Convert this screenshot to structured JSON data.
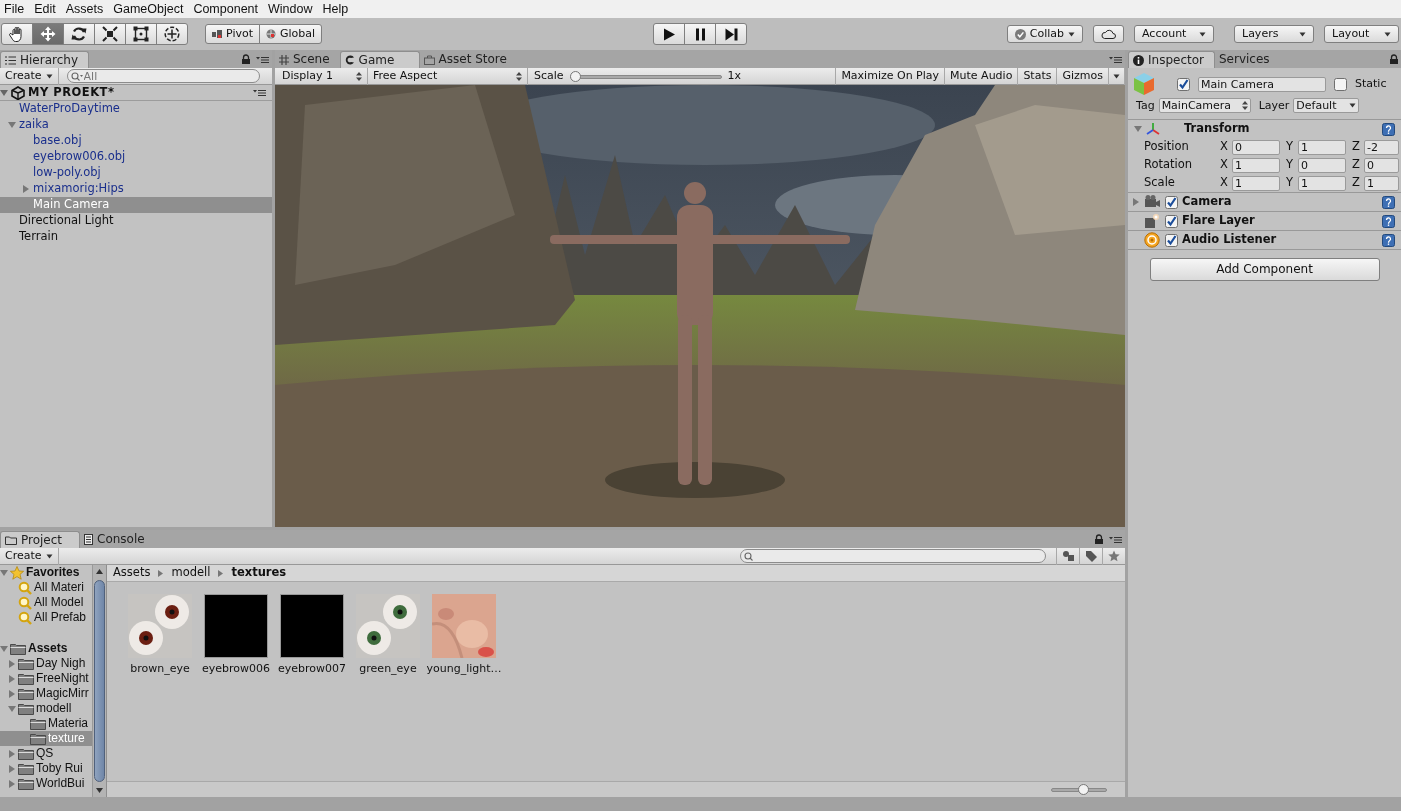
{
  "menu": [
    "File",
    "Edit",
    "Assets",
    "GameObject",
    "Component",
    "Window",
    "Help"
  ],
  "toolbar": {
    "tools": [
      {
        "kind": "hand",
        "selected": false
      },
      {
        "kind": "move",
        "selected": true
      },
      {
        "kind": "rotate",
        "selected": false
      },
      {
        "kind": "scale",
        "selected": false
      },
      {
        "kind": "rect",
        "selected": false
      },
      {
        "kind": "transform",
        "selected": false
      }
    ],
    "handles": [
      {
        "kind": "pivot",
        "label": "Pivot"
      },
      {
        "kind": "global",
        "label": "Global"
      }
    ],
    "playback": [
      {
        "kind": "play"
      },
      {
        "kind": "pause"
      },
      {
        "kind": "step"
      }
    ],
    "collab": "Collab",
    "account": "Account",
    "layers": "Layers",
    "layout": "Layout"
  },
  "hierarchy": {
    "tab": "Hierarchy",
    "create": "Create",
    "search": {
      "placeholder": "All"
    },
    "scene": "MY PROEKT*",
    "items": [
      {
        "label": "WaterProDaytime",
        "kind": "prefab",
        "selected": false
      },
      {
        "label": "zaika",
        "kind": "prefab",
        "selected": false,
        "expanded": true,
        "children": [
          {
            "label": "base.obj",
            "kind": "prefab",
            "selected": false
          },
          {
            "label": "eyebrow006.obj",
            "kind": "prefab",
            "selected": false
          },
          {
            "label": "low-poly.obj",
            "kind": "prefab",
            "selected": false
          },
          {
            "label": "mixamorig:Hips",
            "kind": "prefab",
            "selected": false,
            "expanded": false
          },
          {
            "label": "Main Camera",
            "kind": "object",
            "selected": true
          }
        ]
      },
      {
        "label": "Directional Light",
        "kind": "object",
        "selected": false
      },
      {
        "label": "Terrain",
        "kind": "object",
        "selected": false
      }
    ]
  },
  "game": {
    "tabs": [
      {
        "label": "Scene",
        "kind": "scene",
        "selected": false
      },
      {
        "label": "Game",
        "kind": "game",
        "selected": true
      },
      {
        "label": "Asset Store",
        "kind": "store",
        "selected": false
      }
    ],
    "display": "Display 1",
    "aspect": "Free Aspect",
    "scale_label": "Scale",
    "scale": {
      "level": 0.0
    },
    "scale_reading": "1x",
    "toggles": [
      {
        "label": "Maximize On Play",
        "on": false
      },
      {
        "label": "Mute Audio",
        "on": false
      },
      {
        "label": "Stats",
        "on": false
      },
      {
        "label": "Gizmos",
        "on": false
      }
    ]
  },
  "inspector": {
    "tabs": [
      {
        "label": "Inspector",
        "selected": true
      },
      {
        "label": "Services",
        "selected": false
      }
    ],
    "object": {
      "active": true,
      "name": "Main Camera",
      "static": false,
      "static_label": "Static",
      "tag_label": "Tag",
      "tag": "MainCamera",
      "layer_label": "Layer",
      "layer": "Default"
    },
    "transform": {
      "title": "Transform",
      "rows": [
        {
          "label": "Position",
          "fields": [
            {
              "axis": "X",
              "value": "0"
            },
            {
              "axis": "Y",
              "value": "1"
            },
            {
              "axis": "Z",
              "value": "-2"
            }
          ]
        },
        {
          "label": "Rotation",
          "fields": [
            {
              "axis": "X",
              "value": "1"
            },
            {
              "axis": "Y",
              "value": "0"
            },
            {
              "axis": "Z",
              "value": "0"
            }
          ]
        },
        {
          "label": "Scale",
          "fields": [
            {
              "axis": "X",
              "value": "1"
            },
            {
              "axis": "Y",
              "value": "1"
            },
            {
              "axis": "Z",
              "value": "1"
            }
          ]
        }
      ]
    },
    "components": [
      {
        "kind": "camera",
        "name": "Camera",
        "enabled": true,
        "expanded": false
      },
      {
        "kind": "flare",
        "name": "Flare Layer",
        "enabled": true
      },
      {
        "kind": "audio",
        "name": "Audio Listener",
        "enabled": true
      }
    ],
    "add_button": "Add Component"
  },
  "project": {
    "tabs": [
      {
        "label": "Project",
        "kind": "project",
        "selected": true
      },
      {
        "label": "Console",
        "kind": "console",
        "selected": false
      }
    ],
    "create": "Create",
    "tree": [
      {
        "label": "Favorites",
        "kind": "favorites",
        "selected": false,
        "expanded": true,
        "children": [
          {
            "label": "All Materi",
            "kind": "search",
            "selected": false
          },
          {
            "label": "All Model",
            "kind": "search",
            "selected": false
          },
          {
            "label": "All Prefab",
            "kind": "search",
            "selected": false
          }
        ]
      },
      {
        "label": "Assets",
        "kind": "root",
        "selected": false,
        "expanded": true,
        "children": [
          {
            "label": "Day Nigh",
            "kind": "folder",
            "selected": false,
            "expanded": false
          },
          {
            "label": "FreeNight",
            "kind": "folder",
            "selected": false,
            "expanded": false
          },
          {
            "label": "MagicMirr",
            "kind": "folder",
            "selected": false,
            "expanded": false
          },
          {
            "label": "modell",
            "kind": "folder",
            "selected": false,
            "expanded": true,
            "children": [
              {
                "label": "Materia",
                "kind": "folder",
                "selected": false
              },
              {
                "label": "texture",
                "kind": "folder",
                "selected": true
              }
            ]
          },
          {
            "label": "QS",
            "kind": "folder",
            "selected": false,
            "expanded": false
          },
          {
            "label": "Toby Rui",
            "kind": "folder",
            "selected": false,
            "expanded": false
          },
          {
            "label": "WorldBui",
            "kind": "folder",
            "selected": false,
            "expanded": false
          }
        ]
      }
    ],
    "breadcrumb": [
      "Assets",
      "modell",
      "textures"
    ],
    "assets": [
      {
        "name": "brown_eye",
        "kind": "picture"
      },
      {
        "name": "eyebrow006",
        "kind": "blank"
      },
      {
        "name": "eyebrow007",
        "kind": "blank"
      },
      {
        "name": "green_eye",
        "kind": "picture"
      },
      {
        "name": "young_light…",
        "kind": "picture"
      }
    ],
    "size": {
      "level": 0.6
    }
  }
}
